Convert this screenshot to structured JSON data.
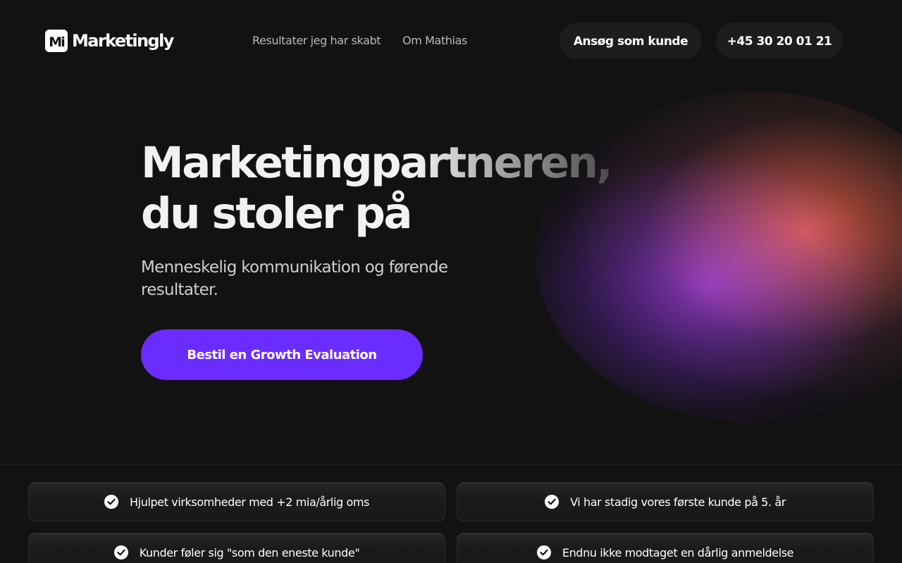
{
  "brand": {
    "logo_mark": "Mi",
    "name": "Marketingly"
  },
  "nav": {
    "links": [
      {
        "label": "Resultater jeg har skabt"
      },
      {
        "label": "Om Mathias"
      }
    ],
    "apply_button": "Ansøg som kunde",
    "phone_button": "+45 30 20 01 21"
  },
  "hero": {
    "title_line1": "Marketingpartneren,",
    "title_line2": "du stoler på",
    "subtitle": "Menneskelig kommunikation og førende resultater.",
    "cta_label": "Bestil en Growth Evaluation"
  },
  "features": [
    {
      "text": "Hjulpet virksomheder med +2 mia/årlig oms",
      "icon": "check-circle-icon"
    },
    {
      "text": "Vi har stadig vores første kunde på 5. år",
      "icon": "check-circle-icon"
    },
    {
      "text": "Kunder føler sig \"som den eneste kunde\"",
      "icon": "check-circle-icon"
    },
    {
      "text": "Endnu ikke modtaget en dårlig anmeldelse",
      "icon": "check-circle-icon"
    }
  ],
  "colors": {
    "background": "#121212",
    "accent": "#6a2cff",
    "pill_background": "#1d1d1d",
    "glow_purple": "#7a2cbe",
    "glow_orange": "#d64e1c"
  }
}
